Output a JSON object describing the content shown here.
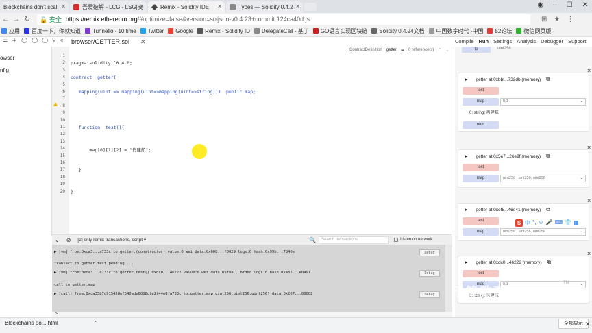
{
  "browser": {
    "tabs": [
      {
        "label": "Blockchains don't scal",
        "active": false
      },
      {
        "label": "吾爱破解 - LCG - LSG|安",
        "active": false
      },
      {
        "label": "Remix - Solidity IDE",
        "active": true
      },
      {
        "label": "Types — Solidity 0.4.2",
        "active": false
      }
    ],
    "secure_label": "安全",
    "url_host": "https://remix.ethereum.org",
    "url_rest": "/#optimize=false&version=soljson-v0.4.23+commit.124ca40d.js"
  },
  "bookmarks": [
    {
      "label": "应用",
      "color": "#4285f4"
    },
    {
      "label": "百度一下，你就知道",
      "color": "#2932e1"
    },
    {
      "label": "Tunnello - 10 time",
      "color": "#7a3cc8"
    },
    {
      "label": "Twitter",
      "color": "#1da1f2"
    },
    {
      "label": "Google",
      "color": "#ea4335"
    },
    {
      "label": "Remix - Solidity ID",
      "color": "#555555"
    },
    {
      "label": "DelegateCall - 基丁",
      "color": "#888888"
    },
    {
      "label": "GO语言实现区块链",
      "color": "#c5221f"
    },
    {
      "label": "Solidity 0.4.24文档",
      "color": "#666666"
    },
    {
      "label": "中国数字时代 -中国",
      "color": "#999999"
    },
    {
      "label": "52论坛",
      "color": "#e53935"
    },
    {
      "label": "微信网页版",
      "color": "#2db52d"
    }
  ],
  "remix": {
    "file_tab": "browser/GETTER.sol",
    "right_tabs": [
      "Compile",
      "Run",
      "Settings",
      "Analysis",
      "Debugger",
      "Support"
    ],
    "active_right_tab": "Run",
    "left_items": [
      "owser",
      "nfig"
    ],
    "defbar": {
      "kind": "ContractDefinition",
      "name": "getter",
      "refs": "0 reference(s)"
    }
  },
  "code": {
    "lines": [
      {
        "n": "1",
        "text": ""
      },
      {
        "n": "2",
        "text": "pragma solidity ^0.4.0;"
      },
      {
        "n": "3",
        "text": ""
      },
      {
        "n": "4",
        "text": "contract  getter{"
      },
      {
        "n": "5",
        "text": ""
      },
      {
        "n": "6",
        "text": "   mapping(uint => mapping(uint=>mapping(uint=>string)))  public map;"
      },
      {
        "n": "7",
        "text": ""
      },
      {
        "n": "8",
        "text": ""
      },
      {
        "n": "9",
        "text": ""
      },
      {
        "n": "10",
        "text": ""
      },
      {
        "n": "11",
        "text": "   function  test(){"
      },
      {
        "n": "12",
        "text": ""
      },
      {
        "n": "13",
        "text": ""
      },
      {
        "n": "14",
        "text": "       map[0][1][2] = \"肖建航\";"
      },
      {
        "n": "15",
        "text": ""
      },
      {
        "n": "16",
        "text": ""
      },
      {
        "n": "17",
        "text": "   }"
      },
      {
        "n": "18",
        "text": ""
      },
      {
        "n": "19",
        "text": ""
      },
      {
        "n": "20",
        "text": "}"
      }
    ]
  },
  "terminal": {
    "filter": "[2] only remix transactions, script",
    "search_placeholder": "Search transactions",
    "listen_label": "Listen on network",
    "logs": [
      {
        "text": "▶ [vm]  from:0xca3...a733c to:getter.(constructor) value:0 wei data:0x608...f0029 logs:0 hash:0x99b...7840e",
        "debug": true
      },
      {
        "text": "transact to getter.test pending ...",
        "debug": false
      },
      {
        "text": "▶ [vm]  from:0xca3...a733c to:getter.test() 0xdc0...46222 value:0 wei data:0xf8a...8fd6d logs:0 hash:0x487...e0491",
        "debug": true
      },
      {
        "text": "call to getter.map",
        "debug": false
      },
      {
        "text": "▶ [call]  from:0xca35b7d915458ef540ade6068dfe2f44e8fa733c to:getter.map(uint256,uint256,uint256) data:0x207...00002",
        "debug": true
      }
    ],
    "debug_label": "Debug",
    "prompt": ">"
  },
  "right_panel": {
    "top_value": "uint256",
    "top_btn": "tp",
    "cards": [
      {
        "title": "getter at 0xbbf...732db (memory)",
        "buttons": [
          {
            "label": "test",
            "kind": "red",
            "input": ""
          },
          {
            "label": "map",
            "kind": "blue",
            "input": "0,1"
          }
        ],
        "result": "0: string: 肖建航",
        "extra_button": "num"
      },
      {
        "title": "getter at 0x5e7...26e9f (memory)",
        "buttons": [
          {
            "label": "test",
            "kind": "red",
            "input": ""
          },
          {
            "label": "map",
            "kind": "blue",
            "input": "uint256 , uint256, uint256"
          }
        ]
      },
      {
        "title": "getter at 0xef5...46e41 (memory)",
        "buttons": [
          {
            "label": "test",
            "kind": "red",
            "input": ""
          },
          {
            "label": "map",
            "kind": "blue",
            "input": "uint256 , uint256, uint256"
          }
        ]
      },
      {
        "title": "getter at 0xdc0...46222 (memory)",
        "buttons": [
          {
            "label": "test",
            "kind": "red",
            "input": ""
          },
          {
            "label": "map",
            "kind": "blue",
            "input": "0,1"
          }
        ],
        "result": "0: string: 肖建航"
      }
    ]
  },
  "statusbar": {
    "download": "Blockchains do....html",
    "show_all": "全部显示"
  },
  "overlay": {
    "ime_label": "中",
    "watermark": "千锋教育",
    "tm": "TM"
  }
}
